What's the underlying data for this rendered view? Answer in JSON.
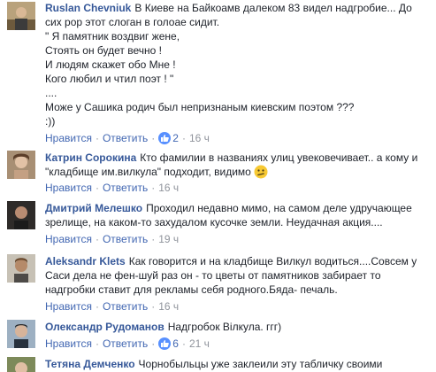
{
  "comments": [
    {
      "author": "Ruslan Chevniuk",
      "lines": [
        "В Киеве на Байкоамв далеком 83 видел надгробие... До",
        "сих рор этот слоган в голоае сидит.",
        "\" Я памятник воздвиг жене,",
        "Стоять он будет вечно !",
        "И людям скажет обо Мне !",
        "Кого любил и чтил поэт ! \"",
        "....",
        "Може у Сашика родич был непризнаным киевским поэтом ???",
        ":))"
      ],
      "like": "Нравится",
      "reply": "Ответить",
      "likes": "2",
      "time": "16 ч"
    },
    {
      "author": "Катрин Сорокина",
      "lines": [
        "Кто фамилии в названиях улиц увековечивает.. а кому и",
        "\"кладбище им.вилкула\" подходит, видимо"
      ],
      "emoji": "confused-face",
      "like": "Нравится",
      "reply": "Ответить",
      "time": "16 ч"
    },
    {
      "author": "Дмитрий Мелешко",
      "lines": [
        "Проходил недавно мимо, на самом деле удручающее",
        "зрелище, на каком-то захудалом кусочке земли. Неудачная акция...."
      ],
      "like": "Нравится",
      "reply": "Ответить",
      "time": "19 ч"
    },
    {
      "author": "Aleksandr Klets",
      "lines": [
        "Как говорится и на кладбище Вилкул водиться....Совсем у",
        "Саси дела не фен-шуй раз он - то цветы от памятников забирает то",
        "надгробки ставит для рекламы себя родного.Бяда- печаль."
      ],
      "like": "Нравится",
      "reply": "Ответить",
      "time": "16 ч"
    },
    {
      "author": "Олександр Рудоманов",
      "lines": [
        "Надгробок Вілкула. ггг)"
      ],
      "like": "Нравится",
      "reply": "Ответить",
      "likes": "6",
      "time": "21 ч"
    },
    {
      "author": "Тетяна Демченко",
      "lines": [
        "Чорнобыльцы уже заклеили эту табличку своими"
      ]
    }
  ]
}
